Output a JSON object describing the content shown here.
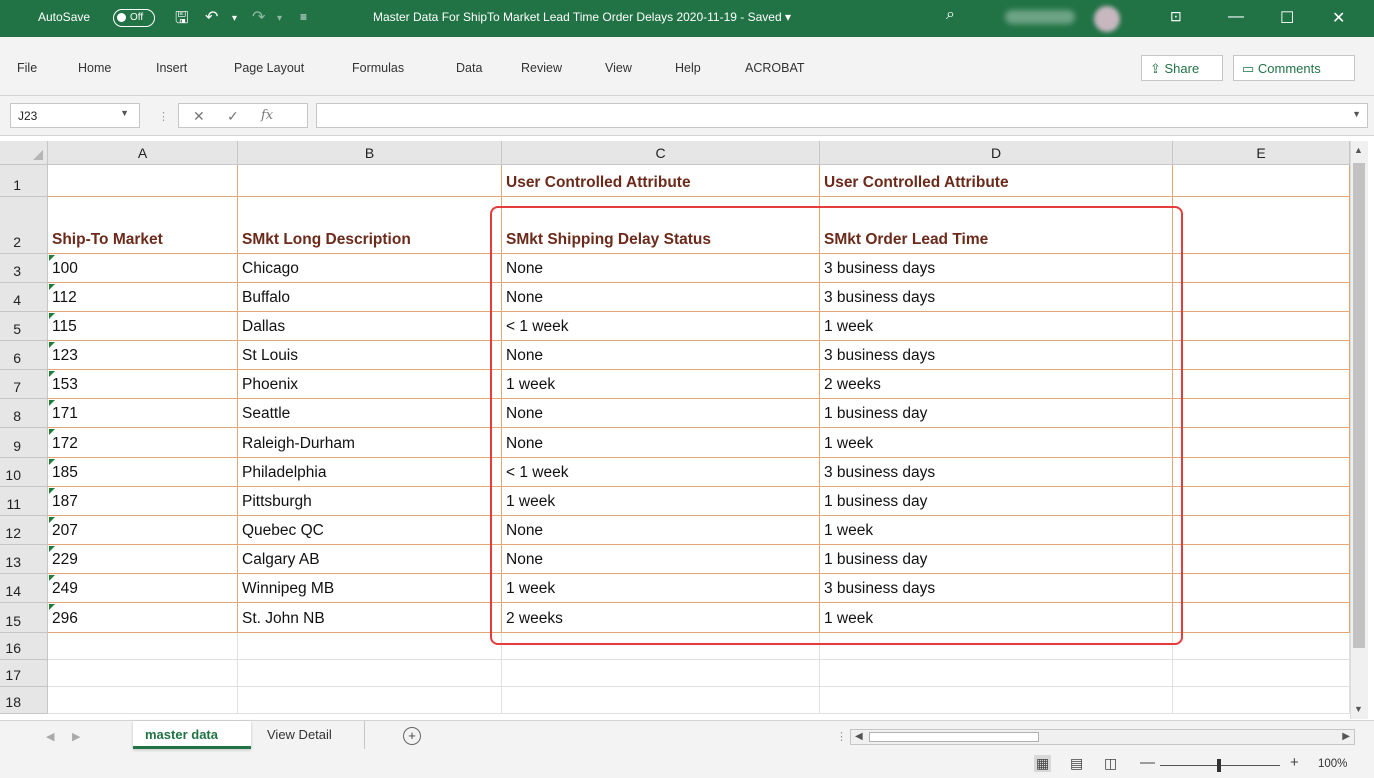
{
  "titlebar": {
    "autosave_label": "AutoSave",
    "autosave_state": "Off",
    "document_title": "Master Data For ShipTo Market Lead Time Order Delays  2020-11-19  -  Saved  ▾",
    "icons": [
      "save-icon",
      "undo-icon",
      "redo-icon",
      "customize-qat-icon",
      "search-icon",
      "ribbon-display-icon",
      "minimize-icon",
      "maximize-icon",
      "close-icon"
    ]
  },
  "menu": {
    "tabs": [
      "File",
      "Home",
      "Insert",
      "Page Layout",
      "Formulas",
      "Data",
      "Review",
      "View",
      "Help",
      "ACROBAT"
    ],
    "share_label": "Share",
    "comments_label": "Comments"
  },
  "formula_bar": {
    "name_box": "J23",
    "formula": ""
  },
  "sheet": {
    "columns": [
      "A",
      "B",
      "C",
      "D",
      "E"
    ],
    "row_numbers": [
      "1",
      "2",
      "3",
      "4",
      "5",
      "6",
      "7",
      "8",
      "9",
      "10",
      "11",
      "12",
      "13",
      "14",
      "15",
      "16",
      "17",
      "18"
    ],
    "row1": [
      "",
      "",
      "User Controlled Attribute",
      "User Controlled Attribute",
      ""
    ],
    "headers": [
      "Ship-To Market",
      "SMkt Long Description",
      "SMkt Shipping Delay Status",
      "SMkt Order Lead Time",
      ""
    ],
    "rows": [
      [
        "100",
        "Chicago",
        "None",
        "3 business days"
      ],
      [
        "112",
        "Buffalo",
        "None",
        "3 business days"
      ],
      [
        "115",
        "Dallas",
        "< 1 week",
        "1 week"
      ],
      [
        "123",
        "St Louis",
        "None",
        "3 business days"
      ],
      [
        "153",
        "Phoenix",
        "1 week",
        "2 weeks"
      ],
      [
        "171",
        "Seattle",
        "None",
        "1 business day"
      ],
      [
        "172",
        "Raleigh-Durham",
        "None",
        "1 week"
      ],
      [
        "185",
        "Philadelphia",
        "< 1 week",
        "3 business days"
      ],
      [
        "187",
        "Pittsburgh",
        "1 week",
        "1 business day"
      ],
      [
        "207",
        "Quebec QC",
        "None",
        "1 week"
      ],
      [
        "229",
        "Calgary AB",
        "None",
        "1 business day"
      ],
      [
        "249",
        "Winnipeg MB",
        "1 week",
        "3 business days"
      ],
      [
        "296",
        "St. John NB",
        "2 weeks",
        "1 week"
      ]
    ],
    "highlight_color": "#e53b3b"
  },
  "sheet_tabs": {
    "active": "master data",
    "other": "View Detail"
  },
  "status": {
    "zoom": "100%"
  },
  "colors": {
    "brand": "#217346",
    "grid_line": "#e3a777",
    "header_text": "#6b2a1a"
  }
}
